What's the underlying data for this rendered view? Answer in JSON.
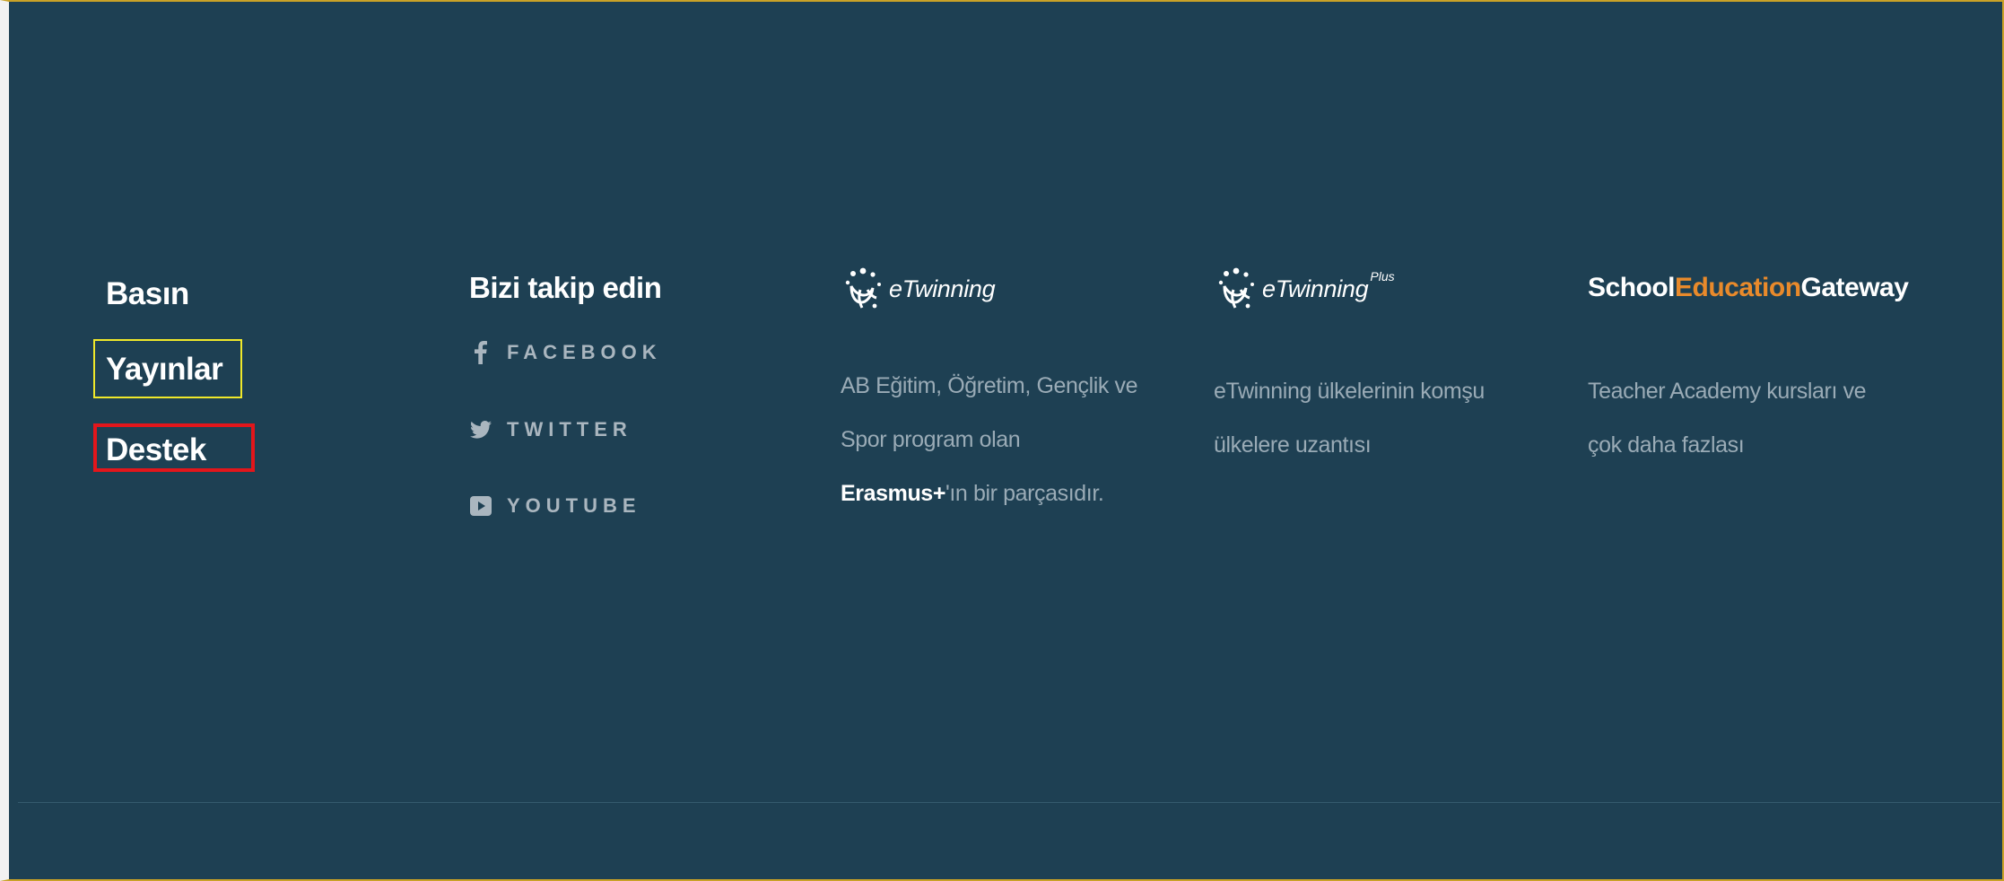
{
  "nav": {
    "basin": "Basın",
    "yayinlar": "Yayınlar",
    "destek": "Destek"
  },
  "social": {
    "title": "Bizi takip edin",
    "items": [
      {
        "icon": "facebook-icon",
        "label": "FACEBOOK"
      },
      {
        "icon": "twitter-icon",
        "label": "TWITTER"
      },
      {
        "icon": "youtube-icon",
        "label": "YOUTUBE"
      }
    ]
  },
  "brands": {
    "etwinning": {
      "logo_text": "eTwinning",
      "desc_part1": "AB Eğitim, Öğretim, Gençlik ve Spor program olan ",
      "desc_strong": "Erasmus+",
      "desc_part2": "'ın bir parçasıdır."
    },
    "etwinning_plus": {
      "logo_text": "eTwinning",
      "logo_sup": "Plus",
      "desc": "eTwinning ülkelerinin komşu ülkelere uzantısı"
    },
    "school_education_gateway": {
      "logo_part1": "School",
      "logo_part2": "Education",
      "logo_part3": "Gateway",
      "desc": "Teacher Academy kursları ve çok daha fazlası"
    }
  },
  "colors": {
    "background": "#1e4053",
    "accent_orange": "#e98a2b",
    "highlight_yellow": "#f0e82a",
    "highlight_red": "#e3161b"
  }
}
